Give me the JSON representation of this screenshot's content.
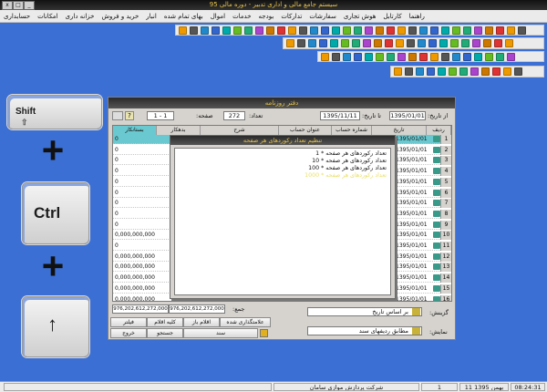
{
  "app": {
    "title": "سیستم جامع مالی و اداری تدبیر - دوره مالی 95",
    "window_controls": [
      "_",
      "□",
      "x"
    ]
  },
  "menu": [
    "حسابداری",
    "امکانات",
    "خزانه داری",
    "خرید و فروش",
    "انبار",
    "بهای تمام شده",
    "اموال",
    "خدمات",
    "بودجه",
    "تدارکات",
    "سفارشات",
    "هوش تجاری",
    "کارتابل",
    "راهنما"
  ],
  "keys": {
    "shift": "Shift",
    "ctrl": "Ctrl",
    "up": "↑",
    "plus": "+"
  },
  "journal": {
    "title": "دفتر روزنامه",
    "from_date_label": "از تاریخ:",
    "from_date": "1395/01/01",
    "to_date_label": "تا تاریخ:",
    "to_date": "1395/11/11",
    "count_label": "تعداد:",
    "count": "272",
    "page_label": "صفحه:",
    "page": "1 - 1",
    "columns": [
      "ردیف",
      "تاریخ",
      "شماره حساب",
      "عنوان حساب",
      "شرح",
      "بدهکار",
      "بستانکار"
    ],
    "rows": [
      {
        "n": "1",
        "date": "1395/01/01",
        "credit": "0"
      },
      {
        "n": "2",
        "date": "1395/01/01",
        "credit": "0"
      },
      {
        "n": "3",
        "date": "1395/01/01",
        "credit": "0"
      },
      {
        "n": "4",
        "date": "1395/01/01",
        "credit": "0"
      },
      {
        "n": "5",
        "date": "1395/01/01",
        "credit": "0"
      },
      {
        "n": "6",
        "date": "1395/01/01",
        "credit": "0"
      },
      {
        "n": "7",
        "date": "1395/01/01",
        "credit": "0"
      },
      {
        "n": "8",
        "date": "1395/01/01",
        "credit": "0"
      },
      {
        "n": "9",
        "date": "1395/01/01",
        "credit": "0"
      },
      {
        "n": "10",
        "date": "1395/01/01",
        "credit": "0,000,000,000,3"
      },
      {
        "n": "11",
        "date": "1395/01/01",
        "credit": "0"
      },
      {
        "n": "12",
        "date": "1395/01/01",
        "credit": "0,000,000,000"
      },
      {
        "n": "13",
        "date": "1395/01/01",
        "credit": "0,000,000,000"
      },
      {
        "n": "14",
        "date": "1395/01/01",
        "credit": "0,000,000,000"
      },
      {
        "n": "15",
        "date": "1395/01/01",
        "credit": "0,000,000,000"
      },
      {
        "n": "16",
        "date": "1395/01/01",
        "credit": "0,000,000,000"
      }
    ],
    "total_label": "جمع:",
    "total_debit": "976,202,612,272,000",
    "total_credit": "976,202,612,272,000",
    "sort_label": "گزینش:",
    "sort_value": "بر اساس تاریخ",
    "display_label": "نمایش:",
    "display_value": "مطابق ردیفهای سند",
    "buttons": {
      "filter": "فیلتر",
      "all_items": "کلیه اقلام",
      "open_items": "اقلام باز",
      "verified": "علامتگذاری شده",
      "exit": "خروج",
      "search": "جستجو",
      "document": "سند"
    }
  },
  "popup": {
    "title": "تنظیم تعداد رکوردهای هر صفحه",
    "options": [
      "تعداد رکوردهای هر صفحه * 1",
      "تعداد رکوردهای هر صفحه * 10",
      "تعداد رکوردهای هر صفحه * 100",
      "تعداد رکوردهای هر صفحه * 1000"
    ]
  },
  "status": {
    "clock": "08:24:31",
    "date": "11 بهمن 1395",
    "user": "1",
    "company": "شرکت پردازش موازی سامان"
  }
}
